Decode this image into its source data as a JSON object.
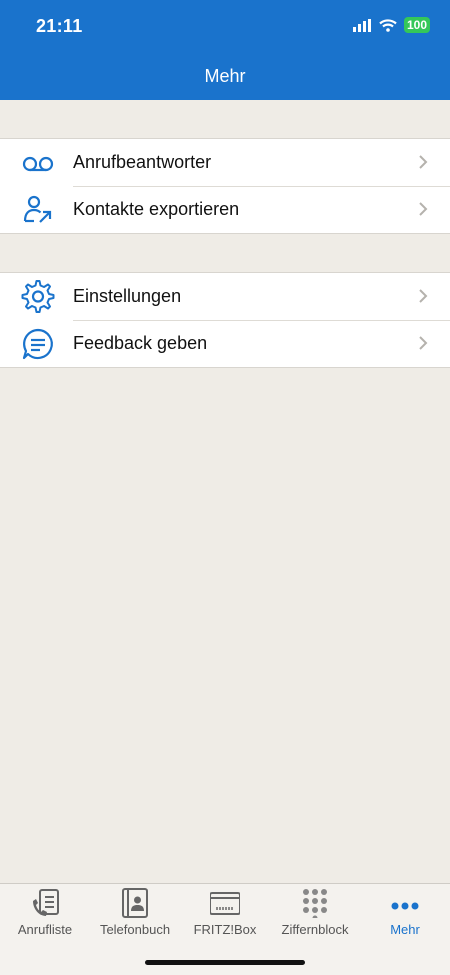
{
  "status_bar": {
    "time": "21:11",
    "battery": "100"
  },
  "header": {
    "title": "Mehr"
  },
  "groups": [
    {
      "items": [
        {
          "label": "Anrufbeantworter",
          "icon": "voicemail-icon"
        },
        {
          "label": "Kontakte exportieren",
          "icon": "contact-export-icon"
        }
      ]
    },
    {
      "items": [
        {
          "label": "Einstellungen",
          "icon": "gear-icon"
        },
        {
          "label": "Feedback geben",
          "icon": "chat-bubble-icon"
        }
      ]
    }
  ],
  "tabs": [
    {
      "label": "Anrufliste",
      "icon": "call-list-icon",
      "active": false
    },
    {
      "label": "Telefonbuch",
      "icon": "phonebook-icon",
      "active": false
    },
    {
      "label": "FRITZ!Box",
      "icon": "router-icon",
      "active": false
    },
    {
      "label": "Ziffernblock",
      "icon": "keypad-icon",
      "active": false
    },
    {
      "label": "Mehr",
      "icon": "more-dots-icon",
      "active": true
    }
  ],
  "colors": {
    "accent": "#1a73cc",
    "background": "#efece6",
    "battery": "#34c759"
  }
}
